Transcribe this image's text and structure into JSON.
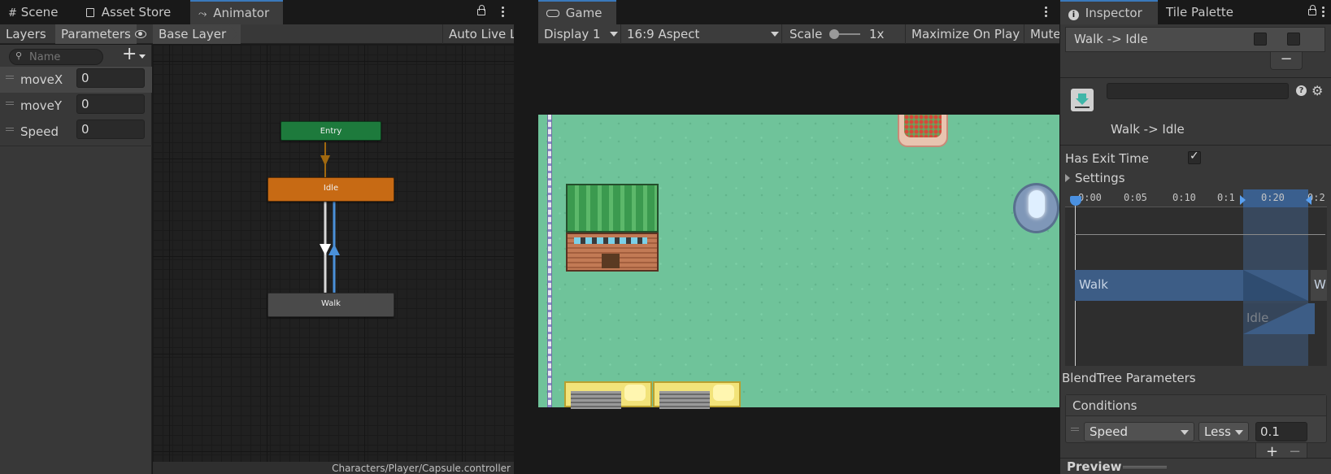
{
  "colors": {
    "accent": "#3a79bb",
    "entry": "#1d7a3c",
    "idle": "#c76a14",
    "walk": "#4a4a4a",
    "grass": "#6fc39a",
    "timeline_clip": "#3d5d86"
  },
  "left_tabs": [
    {
      "label": "Scene",
      "icon": "hash-icon"
    },
    {
      "label": "Asset Store",
      "icon": "bag-icon"
    },
    {
      "label": "Animator",
      "icon": "animator-icon"
    }
  ],
  "animator": {
    "layers_tab": "Layers",
    "parameters_tab": "Parameters",
    "breadcrumb": "Base Layer",
    "auto_live_link": "Auto Live Link",
    "search_placeholder": "Name",
    "add_button": "+",
    "parameters": [
      {
        "name": "moveX",
        "value": "0"
      },
      {
        "name": "moveY",
        "value": "0"
      },
      {
        "name": "Speed",
        "value": "0"
      }
    ],
    "states": {
      "entry": "Entry",
      "idle": "Idle",
      "walk": "Walk"
    },
    "footer_path": "Characters/Player/Capsule.controller"
  },
  "game": {
    "tab_label": "Game",
    "display": "Display 1",
    "aspect": "16:9 Aspect",
    "scale_label": "Scale",
    "scale_value": "1x",
    "maximize": "Maximize On Play",
    "mute": "Mute"
  },
  "inspector": {
    "tabs": [
      "Inspector",
      "Tile Palette"
    ],
    "transition_list_item": "Walk -> Idle",
    "minus": "−",
    "transition_title": "Walk -> Idle",
    "has_exit_time_label": "Has Exit Time",
    "has_exit_time_checked": true,
    "settings_label": "Settings",
    "timeline_ticks": [
      "0:00",
      "0:05",
      "0:10",
      "0:1",
      "0:20",
      "0:2"
    ],
    "timeline_clips": {
      "walk": "Walk",
      "walk_next": "W",
      "idle": "Idle"
    },
    "blend_tree_label": "BlendTree Parameters",
    "conditions_header": "Conditions",
    "condition": {
      "parameter": "Speed",
      "operator": "Less",
      "value": "0.1"
    },
    "add_condition": "+",
    "remove_condition": "−",
    "preview_label": "Preview"
  }
}
